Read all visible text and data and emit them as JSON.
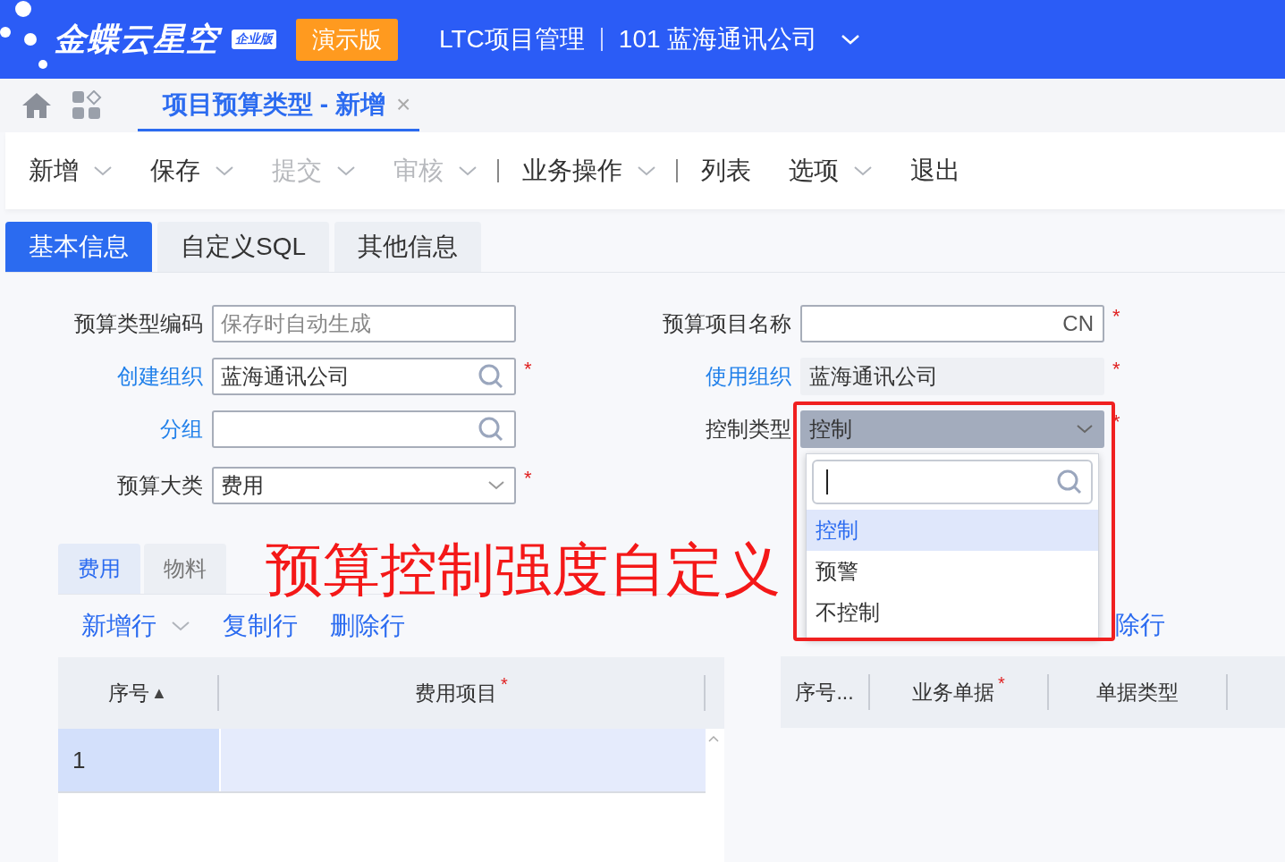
{
  "app": {
    "logo": "金蝶云星空",
    "edition_badge": "企业版",
    "demo_badge": "演示版",
    "product": "LTC项目管理",
    "org": "101 蓝海通讯公司"
  },
  "page_tabs": [
    {
      "label": "项目预算类型 - 新增",
      "selected": true,
      "close": "×"
    }
  ],
  "toolbar": [
    {
      "label": "新增",
      "dropdown": true,
      "disabled": false,
      "separator_after": false
    },
    {
      "label": "保存",
      "dropdown": true,
      "disabled": false,
      "separator_after": false
    },
    {
      "label": "提交",
      "dropdown": true,
      "disabled": true,
      "separator_after": false
    },
    {
      "label": "审核",
      "dropdown": true,
      "disabled": true,
      "separator_after": true
    },
    {
      "label": "业务操作",
      "dropdown": true,
      "disabled": false,
      "separator_after": true
    },
    {
      "label": "列表",
      "dropdown": false,
      "disabled": false,
      "separator_after": false
    },
    {
      "label": "选项",
      "dropdown": true,
      "disabled": false,
      "separator_after": false
    },
    {
      "label": "退出",
      "dropdown": false,
      "disabled": false,
      "separator_after": false
    }
  ],
  "form_tabs": [
    {
      "label": "基本信息",
      "selected": true
    },
    {
      "label": "自定义SQL",
      "selected": false
    },
    {
      "label": "其他信息",
      "selected": false
    }
  ],
  "fields_left": [
    {
      "label": "预算类型编码",
      "link": false,
      "kind": "text",
      "placeholder": "保存时自动生成"
    },
    {
      "label": "创建组织",
      "link": true,
      "kind": "lookup",
      "value": "蓝海通讯公司",
      "required_mark": "*"
    },
    {
      "label": "分组",
      "link": true,
      "kind": "lookup"
    },
    {
      "label": "预算大类",
      "link": false,
      "kind": "select",
      "value": "费用",
      "required_mark": "*"
    }
  ],
  "fields_right": [
    {
      "label": "预算项目名称",
      "link": false,
      "kind": "multilang",
      "suffix": "CN",
      "required_mark": "*"
    },
    {
      "label": "使用组织",
      "link": true,
      "kind": "readonly",
      "value": "蓝海通讯公司",
      "required_mark": "*"
    },
    {
      "label": "控制类型",
      "link": false,
      "kind": "select",
      "value": "控制",
      "required_mark": "*",
      "expanded": true
    }
  ],
  "dropdown": {
    "options": [
      {
        "label": "控制",
        "selected": true
      },
      {
        "label": "预警",
        "selected": false
      },
      {
        "label": "不控制",
        "selected": false
      }
    ]
  },
  "annotation": "预算控制强度自定义",
  "entry_tabs": [
    {
      "label": "费用",
      "selected": true
    },
    {
      "label": "物料",
      "selected": false
    }
  ],
  "entry_toolbar": [
    {
      "label": "新增行",
      "dropdown": true
    },
    {
      "label": "复制行",
      "dropdown": false
    },
    {
      "label": "删除行",
      "dropdown": false
    }
  ],
  "grid": {
    "columns": [
      {
        "label": "序号",
        "sort_icon": "▲"
      },
      {
        "label": "费用项目",
        "required_mark": "*"
      }
    ],
    "rows": [
      {
        "seq": "1",
        "selected": true
      }
    ]
  },
  "right_toolbar": [
    {
      "label": "除行"
    }
  ],
  "right_grid": {
    "columns": [
      {
        "label": "序号..."
      },
      {
        "label": "业务单据",
        "required_mark": "*"
      },
      {
        "label": "单据类型"
      }
    ]
  }
}
